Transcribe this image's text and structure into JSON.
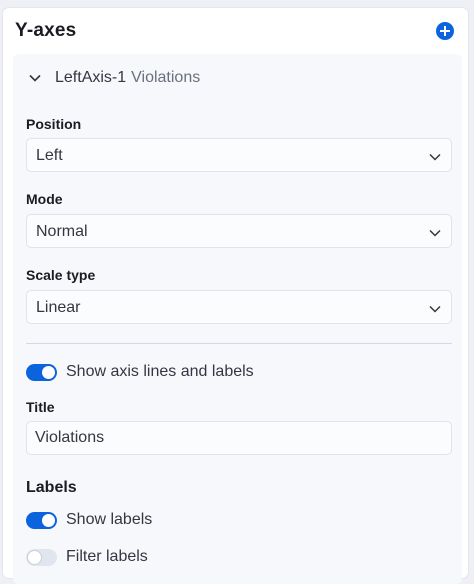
{
  "panel": {
    "title": "Y-axes",
    "add_icon": "plus-circle-icon"
  },
  "axis": {
    "name": "LeftAxis-1",
    "subtitle": "Violations",
    "expanded": true,
    "position": {
      "label": "Position",
      "value": "Left"
    },
    "mode": {
      "label": "Mode",
      "value": "Normal"
    },
    "scale_type": {
      "label": "Scale type",
      "value": "Linear"
    },
    "show_axis_lines": {
      "label": "Show axis lines and labels",
      "on": true
    },
    "title_field": {
      "label": "Title",
      "value": "Violations"
    },
    "labels_section": {
      "title": "Labels",
      "show_labels": {
        "label": "Show labels",
        "on": true
      },
      "filter_labels": {
        "label": "Filter labels",
        "on": false
      }
    }
  },
  "colors": {
    "accent": "#0b64dd",
    "background": "#eef0f5",
    "panel": "#ffffff",
    "axis_box": "#f7f8fc"
  }
}
